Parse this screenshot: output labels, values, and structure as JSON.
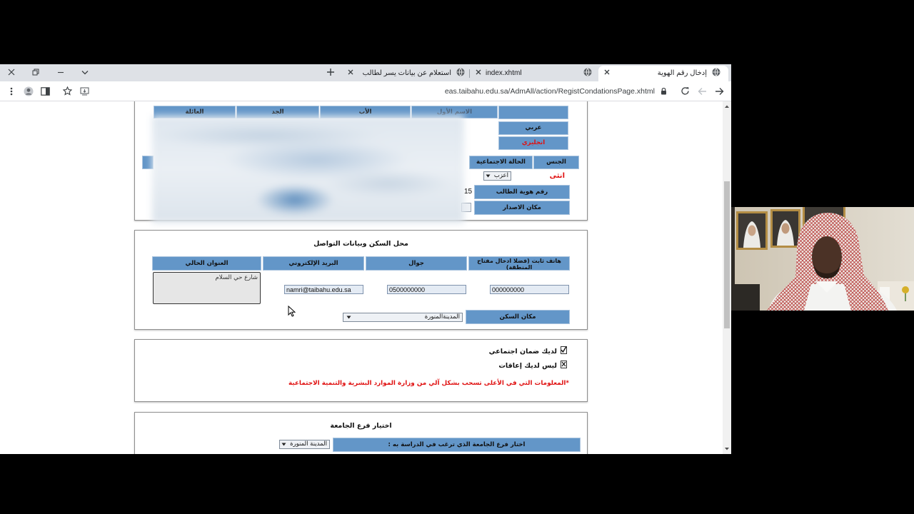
{
  "browser": {
    "tabs": [
      {
        "title": "إدخال رقم الهوية",
        "icon": "globe-icon",
        "active": true
      },
      {
        "title": "index.xhtml",
        "icon": "globe-icon",
        "active": false
      },
      {
        "title": "استعلام عن بيانات يسر لطالب",
        "icon": "globe-icon",
        "active": false
      }
    ],
    "url": "eas.taibahu.edu.sa/AdmAll/action/RegistCondationsPage.xhtml",
    "window_controls": [
      "close-icon",
      "restore-icon",
      "minimize-icon",
      "chevron-down-icon"
    ],
    "toolbar_icons": [
      "back-arrow-icon",
      "forward-arrow-icon",
      "reload-icon",
      "lock-icon",
      "app-install-icon",
      "star-icon",
      "sidebar-icon",
      "profile-icon",
      "menu-dots-icon"
    ]
  },
  "personal": {
    "name_headers": {
      "family": "العائلة",
      "grandfather": "الجد",
      "father": "الأب",
      "first": "الاسم الأول"
    },
    "arabic_label": "عربي",
    "english_label": "انجليزي",
    "gender": {
      "label": "الجنس",
      "value": "انثى"
    },
    "marital_status": {
      "label": "الحالة الاجتماعية",
      "value": "اعزب"
    },
    "student_id": {
      "label": "رقم هوية الطالب",
      "value_visible": "15"
    },
    "issue_place": {
      "label": "مكان الاصدار"
    }
  },
  "contact": {
    "title": "محل السكن وبيانات التواصل",
    "address": {
      "label": "العنوان الحالي",
      "value": "شارع حي السلام"
    },
    "email": {
      "label": "البريد الإلكتروني",
      "value": "namri@taibahu.edu.sa"
    },
    "mobile": {
      "label": "جوال",
      "value": "0500000000"
    },
    "landline": {
      "label": "هاتف ثابت (فضلا ادخال مفتاح المنطقة)",
      "value": "000000000"
    },
    "residence": {
      "label": "مكان السكن",
      "value": "المدينةالمنورة"
    }
  },
  "social": {
    "social_security": {
      "label": "لديك ضمان اجتماعي",
      "checked": true,
      "crossed": false
    },
    "disability": {
      "label": "ليس لديك إعاقات",
      "checked": false,
      "crossed": true
    },
    "note": "*المعلومات التي في الأعلى تسحب بشكل آلي من وزارة الموارد البشرية والتنمية الاجتماعية"
  },
  "branch": {
    "title": "اختيار فرع الجامعة",
    "label": "اختار فرع الجامعة الذي ترغب في الدراسة به :",
    "value": "المدينة المنورة"
  },
  "colors": {
    "header_cell": "#6396c8",
    "alert_red": "#e01010",
    "tab_strip": "#dee1e6"
  }
}
